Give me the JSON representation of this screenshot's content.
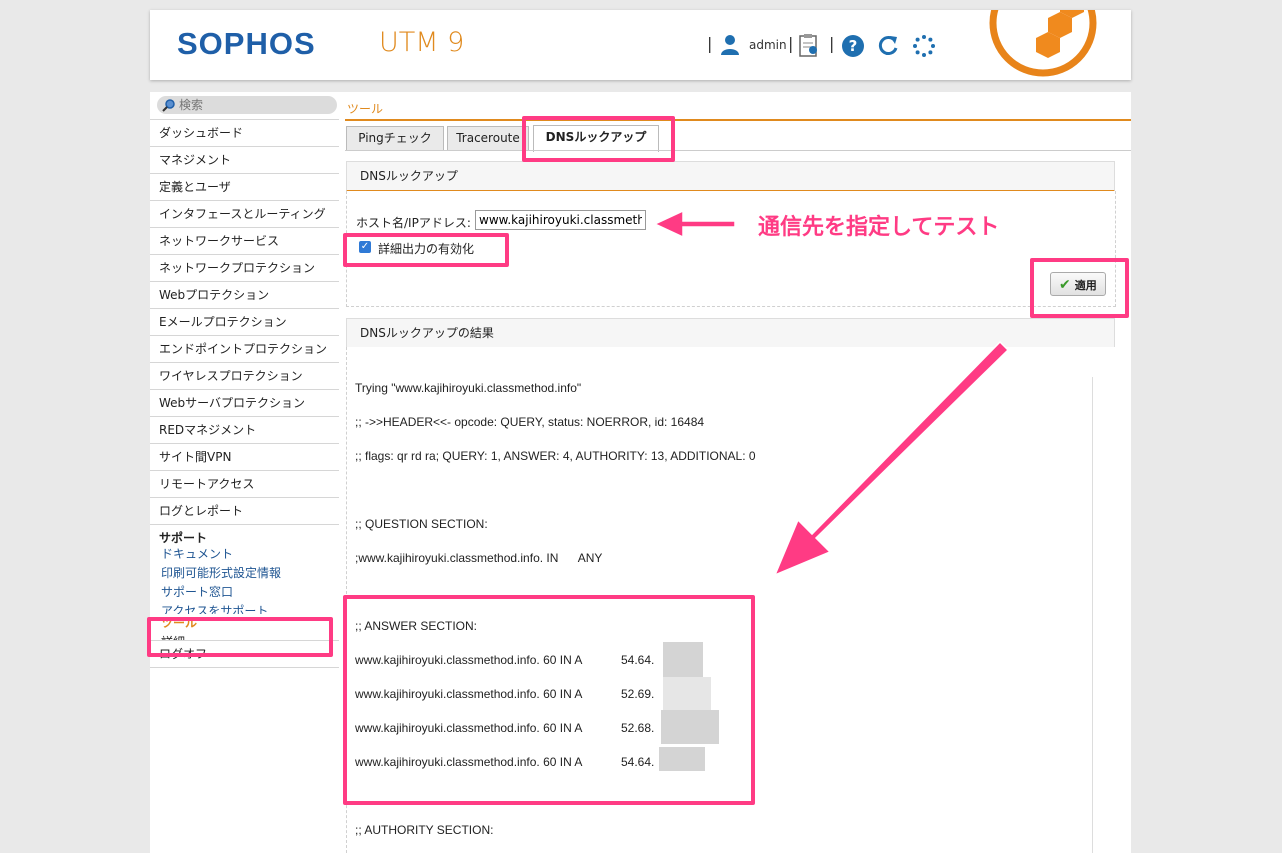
{
  "header": {
    "logo_text": "SOPHOS",
    "product": "UTM 9",
    "separator": "|",
    "user": "admin",
    "help_symbol": "?",
    "icons": [
      "user-icon",
      "clipboard-icon",
      "help-icon",
      "reload-icon",
      "activity-dots-icon"
    ]
  },
  "search": {
    "placeholder": "検索"
  },
  "breadcrumb": "ツール",
  "sidebar": {
    "items": [
      "ダッシュボード",
      "マネジメント",
      "定義とユーザ",
      "インタフェースとルーティング",
      "ネットワークサービス",
      "ネットワークプロテクション",
      "Webプロテクション",
      "Eメールプロテクション",
      "エンドポイントプロテクション",
      "ワイヤレスプロテクション",
      "Webサーバプロテクション",
      "REDマネジメント",
      "サイト間VPN",
      "リモートアクセス",
      "ログとレポート"
    ],
    "support_heading": "サポート",
    "support_items": [
      "ドキュメント",
      "印刷可能形式設定情報",
      "サポート窓口",
      "アクセスをサポート"
    ],
    "tools": "ツール",
    "details": "詳細",
    "logoff": "ログオフ"
  },
  "tabs": [
    "Pingチェック",
    "Traceroute",
    "DNSルックアップ"
  ],
  "dns_box": {
    "title": "DNSルックアップ",
    "host_label": "ホスト名/IPアドレス:",
    "host_value": "www.kajihiroyuki.classmethod.info",
    "verbose_label": "詳細出力の有効化",
    "verbose_checked": true,
    "apply_label": "適用"
  },
  "result_box": {
    "title": "DNSルックアップの結果",
    "lines": [
      "Trying \"www.kajihiroyuki.classmethod.info\"",
      ";; ->>HEADER<<- opcode: QUERY, status: NOERROR, id: 16484",
      ";; flags: qr rd ra; QUERY: 1, ANSWER: 4, AUTHORITY: 13, ADDITIONAL: 0",
      ";; QUESTION SECTION:",
      ";www.kajihiroyuki.classmethod.info. IN      ANY",
      ";; ANSWER SECTION:",
      "www.kajihiroyuki.classmethod.info. 60 IN A",
      "www.kajihiroyuki.classmethod.info. 60 IN A",
      "www.kajihiroyuki.classmethod.info. 60 IN A",
      "www.kajihiroyuki.classmethod.info. 60 IN A",
      ";; AUTHORITY SECTION:"
    ],
    "ips": [
      "54.64.",
      "52.69.",
      "52.68.",
      "54.64."
    ]
  },
  "annotation": {
    "text": "通信先を指定してテスト",
    "color": "#ff3b84"
  },
  "colors": {
    "accent": "#e08a1e",
    "brand": "#1f5fa8",
    "highlight": "#ff3b84"
  }
}
